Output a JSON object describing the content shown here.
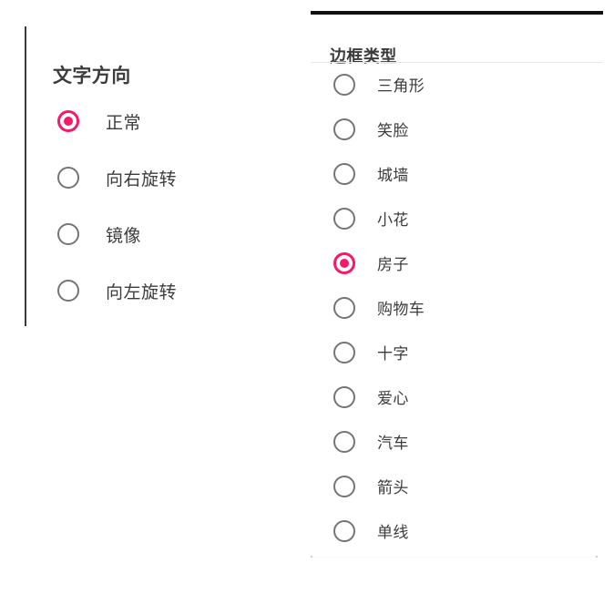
{
  "theme": {
    "accent_color": "#f5186b",
    "radio_unselected_color": "#757575",
    "text_color": "#3c3c3c",
    "background_color": "#ffffff",
    "divider_color": "#e8e8e8",
    "rule_color": "#3a3a3a",
    "top_border_color": "#111111"
  },
  "text_direction_group": {
    "title": "文字方向",
    "selected_index": 0,
    "options": [
      {
        "label": "正常",
        "selected": true
      },
      {
        "label": "向右旋转",
        "selected": false
      },
      {
        "label": "镜像",
        "selected": false
      },
      {
        "label": "向左旋转",
        "selected": false
      }
    ]
  },
  "border_type_group": {
    "title": "边框类型",
    "selected_index": 4,
    "options": [
      {
        "label": "三角形",
        "selected": false
      },
      {
        "label": "笑脸",
        "selected": false
      },
      {
        "label": "城墙",
        "selected": false
      },
      {
        "label": "小花",
        "selected": false
      },
      {
        "label": "房子",
        "selected": true
      },
      {
        "label": "购物车",
        "selected": false
      },
      {
        "label": "十字",
        "selected": false
      },
      {
        "label": "爱心",
        "selected": false
      },
      {
        "label": "汽车",
        "selected": false
      },
      {
        "label": "箭头",
        "selected": false
      },
      {
        "label": "单线",
        "selected": false
      }
    ]
  }
}
